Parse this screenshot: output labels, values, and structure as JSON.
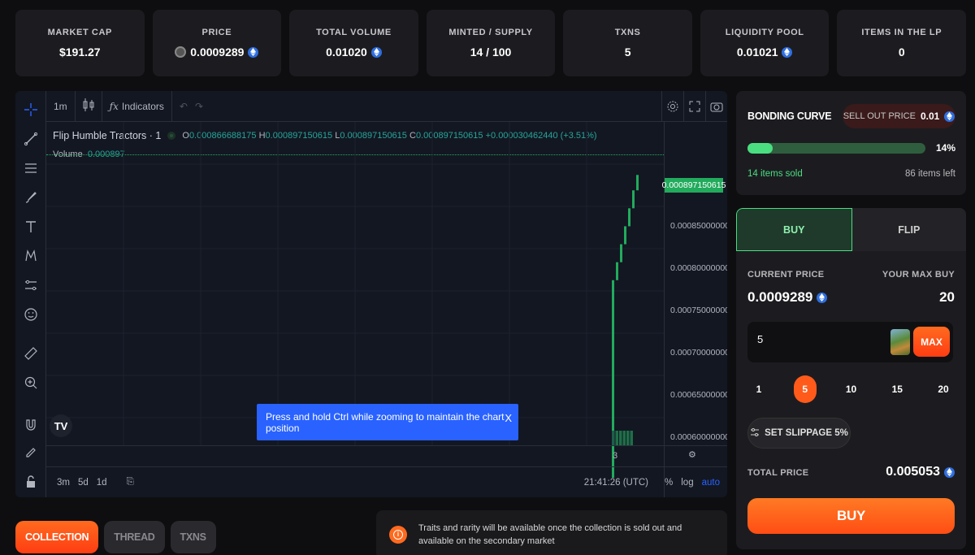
{
  "stats": [
    {
      "label": "MARKET CAP",
      "value": "$191.27",
      "icon": ""
    },
    {
      "label": "PRICE",
      "value": "0.0009289",
      "icon": "eth"
    },
    {
      "label": "TOTAL VOLUME",
      "value": "0.01020",
      "icon": "eth"
    },
    {
      "label": "MINTED / SUPPLY",
      "value": "14 / 100",
      "icon": ""
    },
    {
      "label": "TXNS",
      "value": "5",
      "icon": ""
    },
    {
      "label": "LIQUIDITY POOL",
      "value": "0.01021",
      "icon": "eth"
    },
    {
      "label": "ITEMS IN THE LP",
      "value": "0",
      "icon": ""
    }
  ],
  "chart": {
    "interval": "1m",
    "indicators_label": "Indicators",
    "symbol": "Flip Humble Tractors · 1",
    "ohlc": {
      "o_label": "O",
      "o": "0.000866688175",
      "h_label": "H",
      "h": "0.000897150615",
      "l_label": "L",
      "l": "0.000897150615",
      "c_label": "C",
      "c": "0.000897150615",
      "change": "+0.000030462440 (+3.51%)"
    },
    "volume_label": "Volume",
    "volume_value": "0.000897",
    "last_price": "0.000897150615",
    "price_ticks": [
      "0.000850000000",
      "0.000800000000",
      "0.000750000000",
      "0.000700000000",
      "0.000650000000",
      "0.000600000000"
    ],
    "time_label": "3",
    "range_buttons": [
      "3m",
      "5d",
      "1d"
    ],
    "clock": "21:41:26 (UTC)",
    "scale_buttons": [
      "%",
      "log",
      "auto"
    ],
    "toast": "Press and hold Ctrl while zooming to maintain the chart position",
    "toast_close": "X",
    "colors": {
      "up": "#22ab5c",
      "bg": "#131722"
    }
  },
  "chart_data": {
    "type": "candlestick",
    "title": "",
    "steps": [
      0.00078,
      0.0008,
      0.00082,
      0.00084,
      0.00086,
      0.00088,
      0.000897150615
    ],
    "ylim": [
      0.00056,
      0.00092
    ]
  },
  "tabs": [
    {
      "label": "COLLECTION",
      "active": true
    },
    {
      "label": "THREAD",
      "active": false
    },
    {
      "label": "TXNS",
      "active": false
    }
  ],
  "notice": {
    "icon": "info-icon",
    "text": "Traits and rarity will be available once the collection is sold out and available on the secondary market"
  },
  "bonding": {
    "title": "BONDING CURVE",
    "sellout_label": "SELL OUT PRICE",
    "sellout_value": "0.01",
    "progress_pct": 14,
    "progress_label": "14%",
    "sold": "14 items sold",
    "left": "86 items left"
  },
  "trade": {
    "buy_tab": "BUY",
    "flip_tab": "FLIP",
    "current_price_label": "CURRENT PRICE",
    "current_price": "0.0009289",
    "max_buy_label": "YOUR MAX BUY",
    "max_buy": "20",
    "quantity": "5",
    "max_label": "MAX",
    "presets": [
      "1",
      "5",
      "10",
      "15",
      "20"
    ],
    "preset_selected": "5",
    "slippage_label": "SET SLIPPAGE 5%",
    "total_price_label": "TOTAL PRICE",
    "total_price": "0.005053",
    "buy_button": "BUY"
  }
}
